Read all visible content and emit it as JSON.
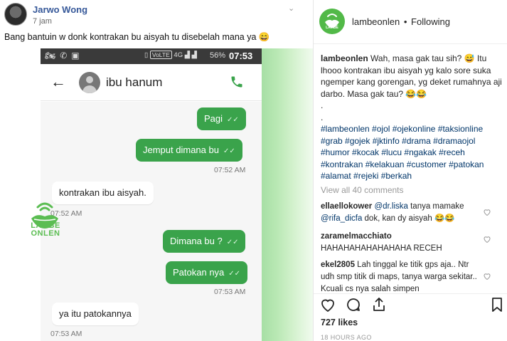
{
  "post": {
    "author": "Jarwo Wong",
    "time": "7 jam",
    "caption": "Bang bantuin w donk kontrakan bu aisyah tu disebelah mana ya 😄"
  },
  "phone": {
    "status": {
      "volte": "VoLTE",
      "network": "4G",
      "battery": "56%",
      "clock": "07:53"
    },
    "contact_name": "ibu hanum",
    "messages": [
      {
        "dir": "out",
        "text": "Pagi"
      },
      {
        "dir": "out",
        "text": "Jemput dimana bu"
      },
      {
        "dir": "stamp_out",
        "text": "07:52 AM"
      },
      {
        "dir": "in",
        "text": "kontrakan ibu aisyah."
      },
      {
        "dir": "stamp_in",
        "text": "07:52 AM"
      },
      {
        "dir": "out",
        "text": "Dimana bu ?"
      },
      {
        "dir": "out",
        "text": "Patokan nya"
      },
      {
        "dir": "stamp_out",
        "text": "07:53 AM"
      },
      {
        "dir": "in",
        "text": "ya itu patokannya"
      },
      {
        "dir": "stamp_in",
        "text": "07:53 AM"
      }
    ],
    "watermark": "LAMBE ONLEN"
  },
  "instagram": {
    "account": "lambeonlen",
    "follow_state": "Following",
    "logo_text": "LAMBE",
    "caption_author": "lambeonlen",
    "caption_text": "Wah, masa gak tau sih? 😅 Itu lhooo kontrakan ibu aisyah yg kalo sore suka ngemper kang gorengan, yg deket rumahnya aji darbo. Masa gak tau? 😂😂",
    "caption_dots": ".",
    "hashtags": "#lambeonlen #ojol #ojekonline #taksionline #grab #gojek #jktinfo #drama #dramaojol #humor #kocak #lucu #ngakak #receh #kontrakan #kelakuan #customer #patokan #alamat #rejeki #berkah",
    "view_all": "View all 40 comments",
    "comments": [
      {
        "user": "ellaellokower",
        "mention1": "@dr.liska",
        "text1": " tanya mamake",
        "mention2": "@rifa_dicfa",
        "text2": " dok, kan dy aisyah 😂😂"
      },
      {
        "user": "zaramelmacchiato",
        "text": "HAHAHAHAHAHAHAHA RECEH"
      },
      {
        "user": "ekel2805",
        "text": "Lah tinggal ke titik gps aja.. Ntr udh smp titik di maps, tanya warga sekitar.. Kcuali cs nya salah simpen"
      }
    ],
    "likes": "727 likes",
    "ago": "18 HOURS AGO",
    "colors": {
      "brand_green": "#52b948",
      "bubble_green": "#3aa34b",
      "link": "#003569"
    }
  }
}
